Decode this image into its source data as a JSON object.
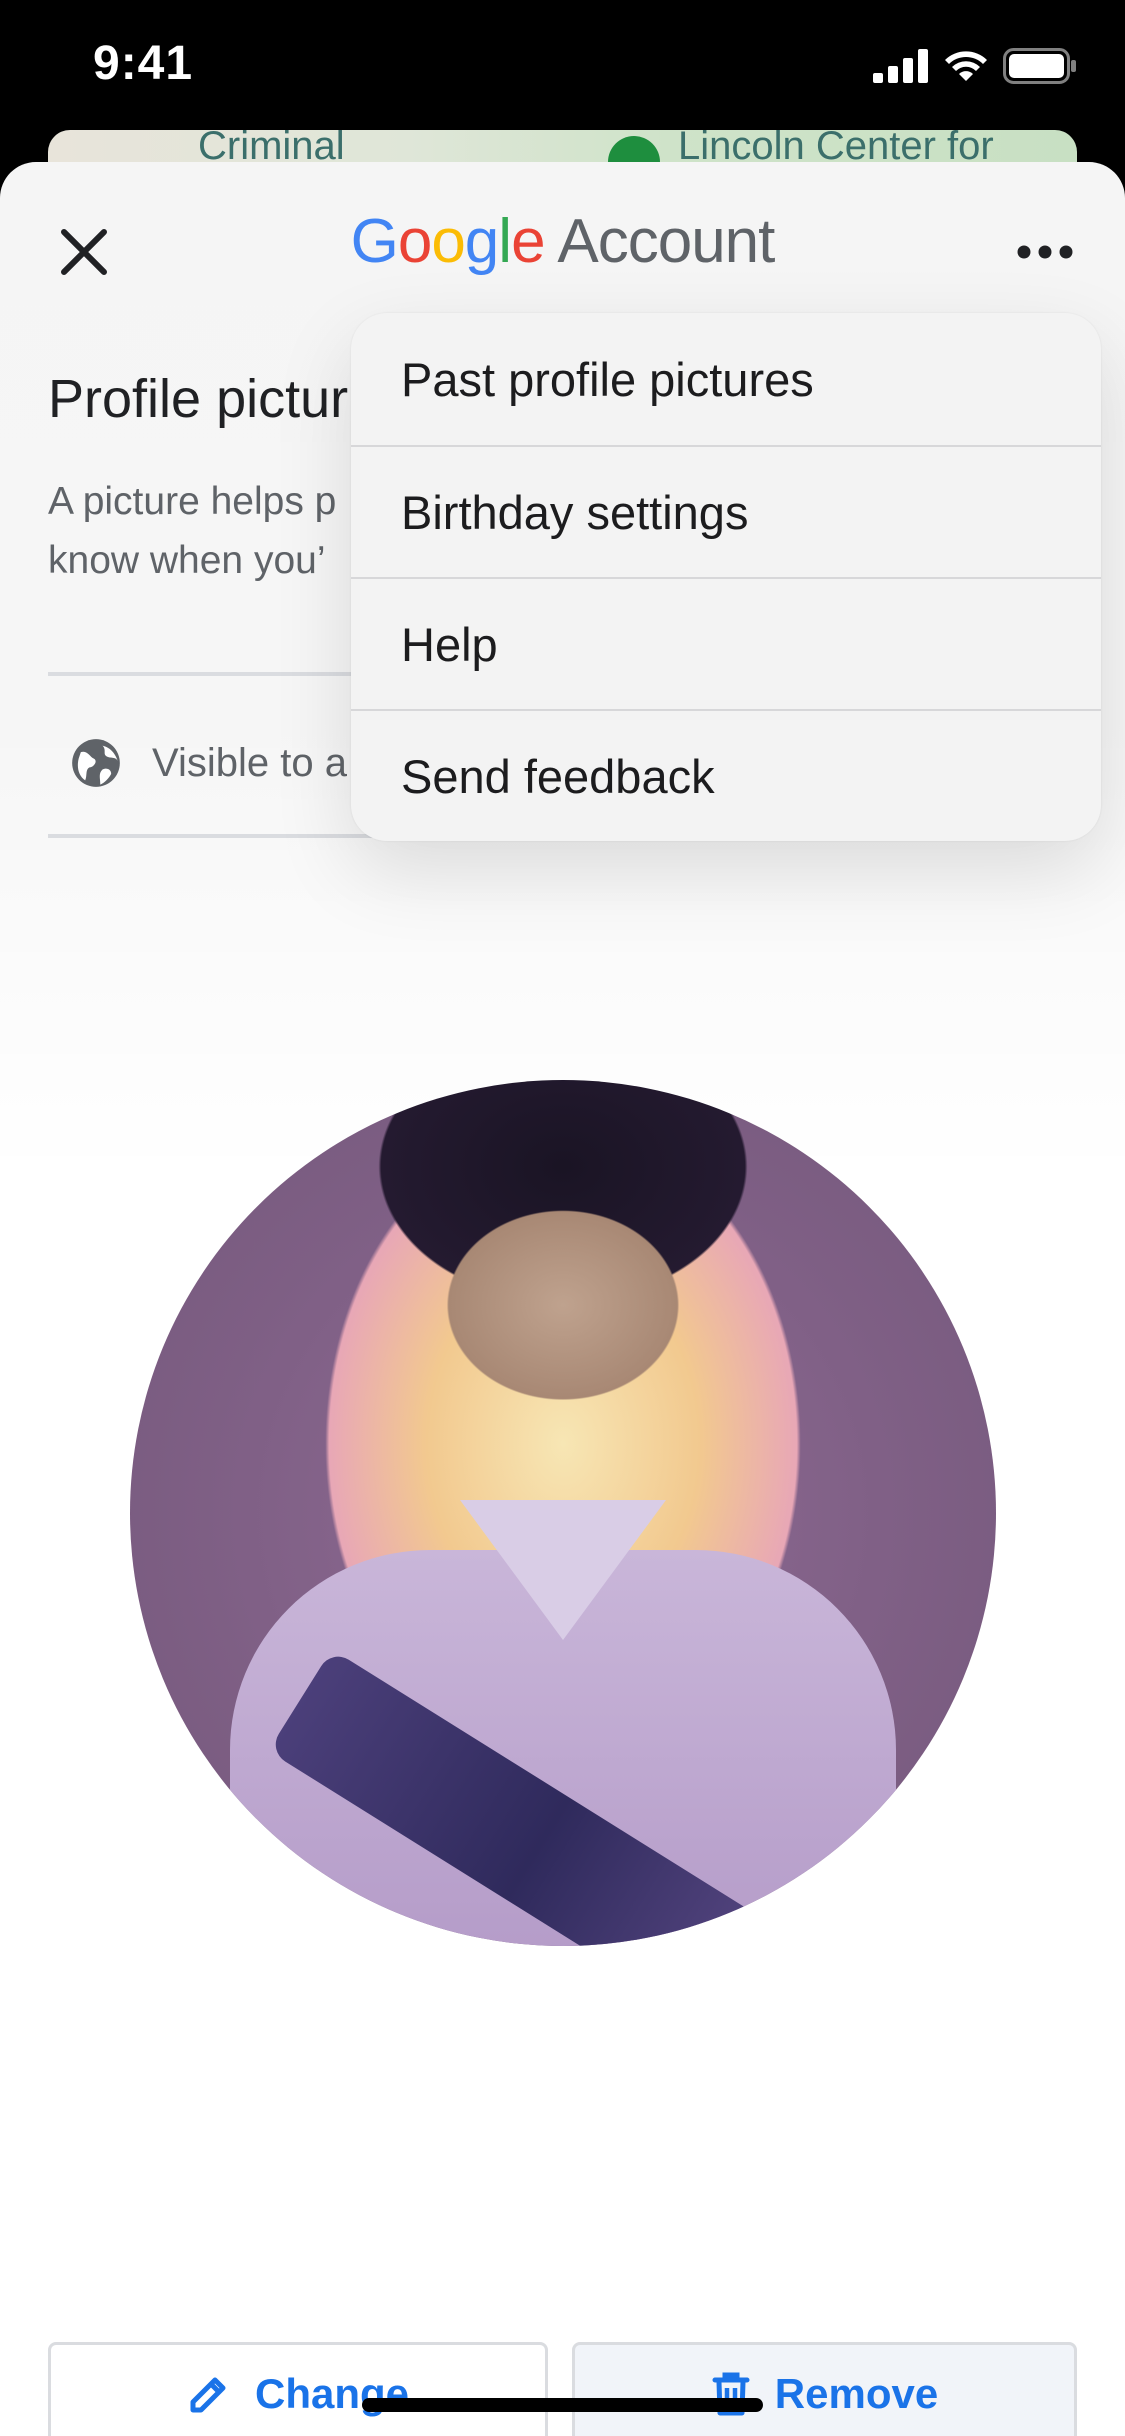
{
  "status_bar": {
    "time": "9:41"
  },
  "map_peek": {
    "left_label": "Criminal",
    "right_label": "Lincoln Center for"
  },
  "header": {
    "brand_letters": [
      "G",
      "o",
      "o",
      "g",
      "l",
      "e"
    ],
    "title_suffix": "Account",
    "close_icon": "close-icon",
    "more_icon": "more-horizontal-icon"
  },
  "section": {
    "title": "Profile pictur",
    "description_line1": "A picture helps p",
    "description_line2": "know when you’",
    "visibility": "Visible to a"
  },
  "menu": {
    "items": [
      "Past profile pictures",
      "Birthday settings",
      "Help",
      "Send feedback"
    ]
  },
  "actions": {
    "change_label": "Change",
    "change_icon": "pencil-icon",
    "remove_label": "Remove",
    "remove_icon": "trash-icon"
  },
  "colors": {
    "accent": "#1a73e8",
    "google_blue": "#4285f4",
    "google_red": "#ea4335",
    "google_yellow": "#fbbc05",
    "google_green": "#34a853"
  }
}
